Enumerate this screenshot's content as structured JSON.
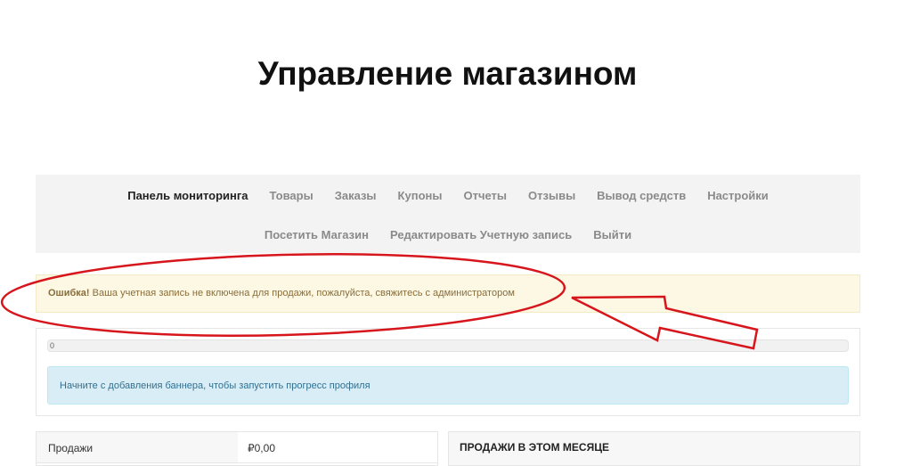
{
  "page": {
    "title": "Управление магазином"
  },
  "nav": {
    "row1": [
      {
        "label": "Панель мониторинга",
        "active": true
      },
      {
        "label": "Товары",
        "active": false
      },
      {
        "label": "Заказы",
        "active": false
      },
      {
        "label": "Купоны",
        "active": false
      },
      {
        "label": "Отчеты",
        "active": false
      },
      {
        "label": "Отзывы",
        "active": false
      },
      {
        "label": "Вывод средств",
        "active": false
      },
      {
        "label": "Настройки",
        "active": false
      }
    ],
    "row2": [
      {
        "label": "Посетить Магазин",
        "active": false
      },
      {
        "label": "Редактировать Учетную запись",
        "active": false
      },
      {
        "label": "Выйти",
        "active": false
      }
    ]
  },
  "alert_error": {
    "prefix": "Ошибка!",
    "message": " Ваша учетная запись не включена для продажи, пожалуйста, свяжитесь с администратором"
  },
  "profile_progress": {
    "percent_label": "0",
    "percent": 0,
    "info_message": "Начните с добавления баннера, чтобы запустить прогресс профиля"
  },
  "stats": {
    "rows": [
      {
        "label": "Продажи",
        "value": "₽0,00"
      }
    ]
  },
  "sales_month": {
    "title": "ПРОДАЖИ В ЭТОМ МЕСЯЦЕ"
  },
  "colors": {
    "annotation": "#d6161c",
    "nav_bg": "#f3f3f3",
    "alert_warning_bg": "#fcf8e3",
    "alert_info_bg": "#d9edf7"
  }
}
